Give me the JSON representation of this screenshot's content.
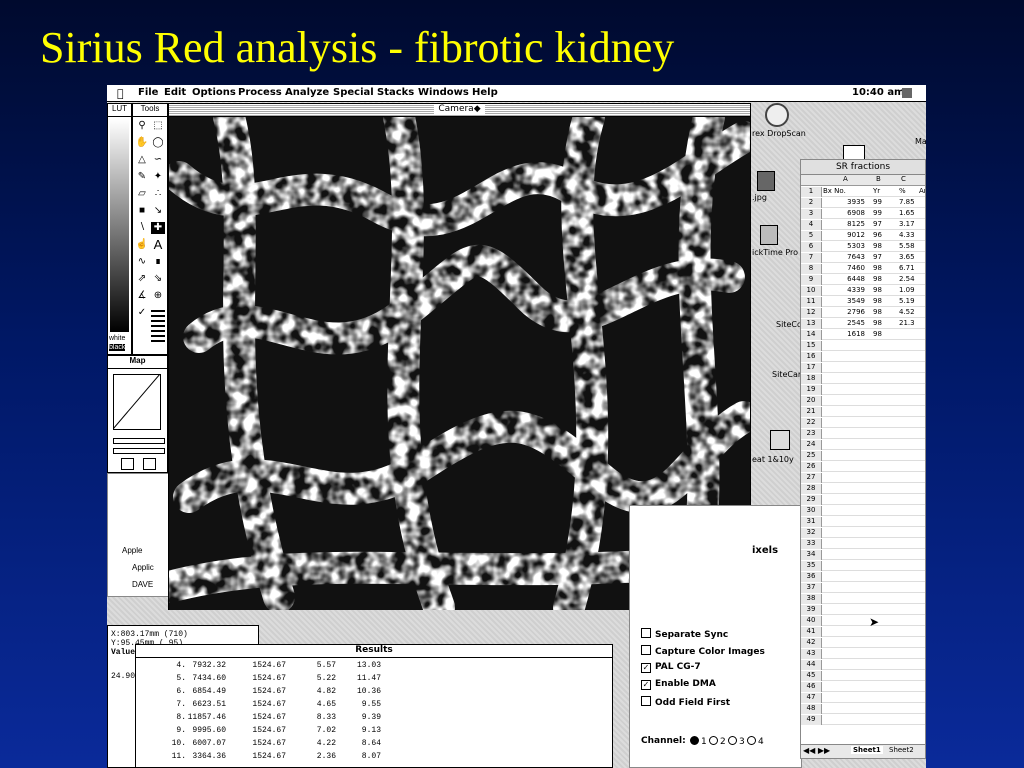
{
  "slide_title": "Sirius Red analysis - fibrotic kidney",
  "menubar": {
    "items": [
      "File",
      "Edit",
      "Options",
      "Process",
      "Analyze",
      "Special",
      "Stacks",
      "Windows",
      "Help"
    ],
    "time": "10:40 am"
  },
  "lut": {
    "title": "LUT",
    "white_label": "white",
    "black_label": "black"
  },
  "tools": {
    "title": "Tools"
  },
  "map": {
    "title": "Map"
  },
  "camera": {
    "title": "Camera◆"
  },
  "desktop": {
    "dropscan": "rex DropScan",
    "jpg": ".jpg",
    "quicktime": "ickTime Pro",
    "sitecd": "SiteCd",
    "sitecar": "SiteCar",
    "feat": "eat 1&10y",
    "ma": "Ma"
  },
  "finder_list": {
    "apple": "Apple",
    "applic": "Applic",
    "dave": "DAVE"
  },
  "status": {
    "x": "X:803.17mm (710)",
    "y": "Y:95.45mm ( 95)",
    "value": "Value",
    "number": "24.90"
  },
  "results": {
    "title": "Results",
    "rows": [
      [
        "4.",
        "7932.32",
        "1524.67",
        "5.57",
        "13.03"
      ],
      [
        "5.",
        "7434.60",
        "1524.67",
        "5.22",
        "11.47"
      ],
      [
        "6.",
        "6854.49",
        "1524.67",
        "4.82",
        "10.36"
      ],
      [
        "7.",
        "6623.51",
        "1524.67",
        "4.65",
        "9.55"
      ],
      [
        "8.",
        "11857.46",
        "1524.67",
        "8.33",
        "9.39"
      ],
      [
        "9.",
        "9995.60",
        "1524.67",
        "7.02",
        "9.13"
      ],
      [
        "10.",
        "6007.07",
        "1524.67",
        "4.22",
        "8.64"
      ],
      [
        "11.",
        "3364.36",
        "1524.67",
        "2.36",
        "8.07"
      ]
    ]
  },
  "capture": {
    "pixels": "ixels",
    "options": [
      {
        "label": "Separate Sync",
        "checked": false
      },
      {
        "label": "Capture Color Images",
        "checked": false
      },
      {
        "label": "PAL CG-7",
        "checked": true
      },
      {
        "label": "Enable DMA",
        "checked": true
      },
      {
        "label": "Odd Field First",
        "checked": false
      }
    ],
    "channel_label": "Channel:",
    "channels": [
      "1",
      "2",
      "3",
      "4"
    ],
    "selected_channel": "1"
  },
  "spreadsheet": {
    "title": "SR fractions",
    "columns": [
      "A",
      "B",
      "C"
    ],
    "header": {
      "row": "1",
      "a": "Bx No.",
      "b": "Yr",
      "c": "%",
      "d": "Ar"
    },
    "rows": [
      {
        "n": "2",
        "a": "3935",
        "b": "99",
        "c": "7.85"
      },
      {
        "n": "3",
        "a": "6908",
        "b": "99",
        "c": "1.65"
      },
      {
        "n": "4",
        "a": "8125",
        "b": "97",
        "c": "3.17"
      },
      {
        "n": "5",
        "a": "9012",
        "b": "96",
        "c": "4.33"
      },
      {
        "n": "6",
        "a": "5303",
        "b": "98",
        "c": "5.58"
      },
      {
        "n": "7",
        "a": "7643",
        "b": "97",
        "c": "3.65"
      },
      {
        "n": "8",
        "a": "7460",
        "b": "98",
        "c": "6.71"
      },
      {
        "n": "9",
        "a": "6448",
        "b": "98",
        "c": "2.54"
      },
      {
        "n": "10",
        "a": "4339",
        "b": "98",
        "c": "1.09"
      },
      {
        "n": "11",
        "a": "3549",
        "b": "98",
        "c": "5.19"
      },
      {
        "n": "12",
        "a": "2796",
        "b": "98",
        "c": "4.52"
      },
      {
        "n": "13",
        "a": "2545",
        "b": "98",
        "c": "21.3"
      },
      {
        "n": "14",
        "a": "1618",
        "b": "98",
        "c": ""
      }
    ],
    "empty_rows": [
      "15",
      "16",
      "17",
      "18",
      "19",
      "20",
      "21",
      "22",
      "23",
      "24",
      "25",
      "26",
      "27",
      "28",
      "29",
      "30",
      "31",
      "32",
      "33",
      "34",
      "35",
      "36",
      "37",
      "38",
      "39",
      "40",
      "41",
      "42",
      "43",
      "44",
      "45",
      "46",
      "47",
      "48",
      "49"
    ],
    "tabs": [
      "Sheet1",
      "Sheet2"
    ]
  }
}
